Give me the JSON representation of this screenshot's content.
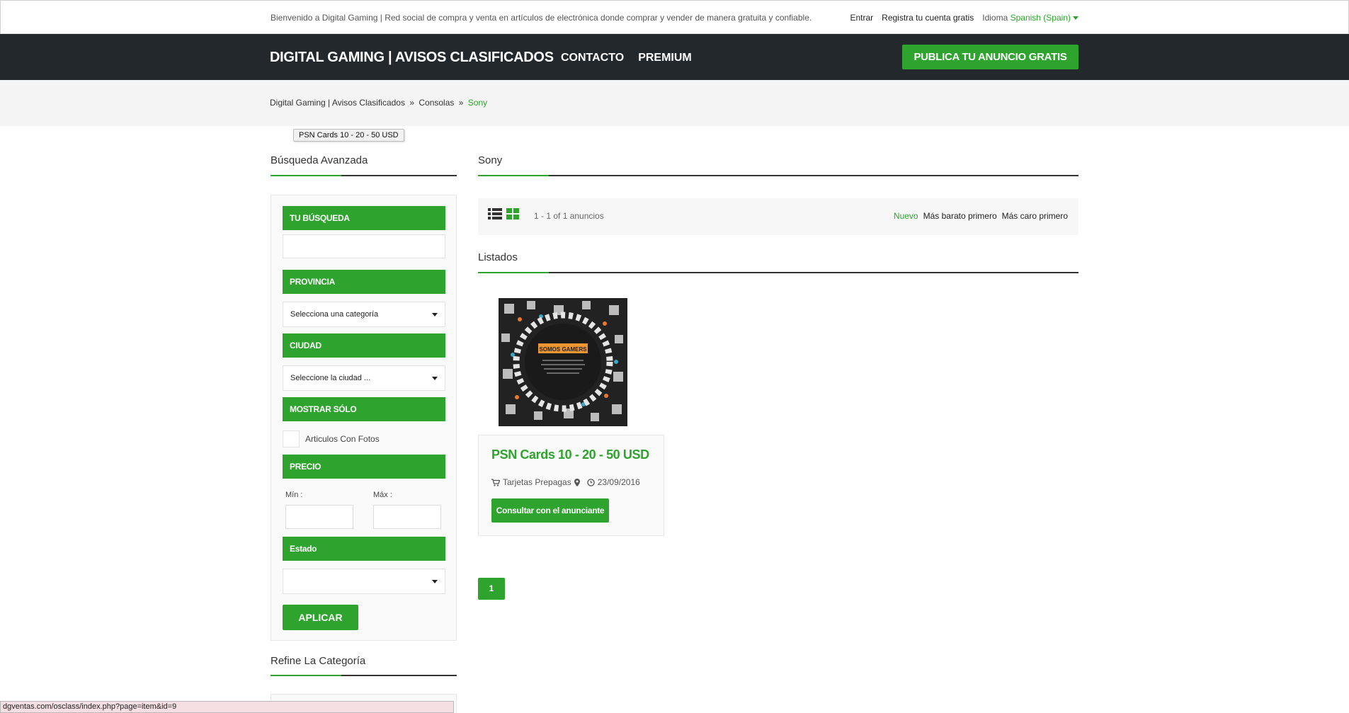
{
  "topbar": {
    "welcome": "Bienvenido a Digital Gaming | Red social de compra y venta en artículos de electrónica donde comprar y vender de manera gratuita y confiable.",
    "login": "Entrar",
    "register": "Registra tu cuenta gratis",
    "language_label": "Idioma",
    "language_value": "Spanish (Spain)"
  },
  "header": {
    "brand": "DIGITAL GAMING | AVISOS CLASIFICADOS",
    "nav": [
      "CONTACTO",
      "PREMIUM"
    ],
    "publish_label": "PUBLICA TU ANUNCIO GRATIS"
  },
  "breadcrumb": {
    "items": [
      "Digital Gaming | Avisos Clasificados",
      "Consolas"
    ],
    "separator": "»",
    "current": "Sony"
  },
  "tooltip": "PSN Cards 10 - 20 - 50 USD",
  "sidebar": {
    "title": "Búsqueda Avanzada",
    "search_label": "TU BÚSQUEDA",
    "province_label": "PROVINCIA",
    "province_value": "Selecciona una categoría",
    "city_label": "CIUDAD",
    "city_value": "Seleccione la ciudad ...",
    "show_only_label": "MOSTRAR SÓLO",
    "photos_label": "Articulos Con Fotos",
    "price_label": "PRECIO",
    "min_label": "Mín :",
    "max_label": "Máx :",
    "state_label": "Estado",
    "state_value": "",
    "apply_label": "APLICAR",
    "refine_title": "Refine La Categoría"
  },
  "main": {
    "title": "Sony",
    "count": "1 - 1 of 1 anuncios",
    "sort": [
      "Nuevo",
      "Más barato primero",
      "Más caro primero"
    ],
    "active_sort": "Nuevo",
    "listings_title": "Listados"
  },
  "listing": {
    "title": "PSN Cards 10 - 20 - 50 USD",
    "category": "Tarjetas Prepagas",
    "date": "23/09/2016",
    "contact_label": "Consultar con el anunciante",
    "image_banner": "SOMOS GAMERS"
  },
  "pagination": {
    "current": "1"
  },
  "status_bar": {
    "url": "dgventas.com/osclass/index.php?page=item&id=9"
  },
  "colors": {
    "accent": "#2ea32e",
    "header_bg": "#23282c",
    "crumb_bg": "#f4f4f4"
  },
  "icons": [
    "list-view-icon",
    "grid-view-icon",
    "cart-icon",
    "map-marker-icon",
    "clock-icon",
    "caret-down-icon"
  ]
}
